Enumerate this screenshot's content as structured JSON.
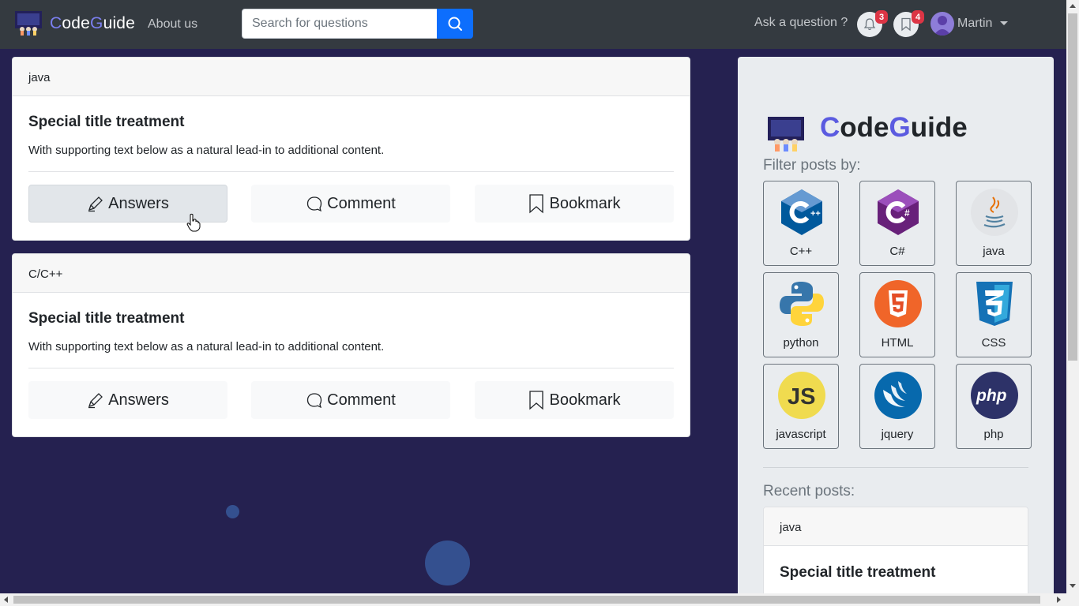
{
  "navbar": {
    "brand_first": "C",
    "brand_mid": "ode",
    "brand_accent": "G",
    "brand_rest": "uide",
    "about": "About us",
    "search_placeholder": "Search for questions",
    "ask": "Ask a question ?",
    "notifications_count": "3",
    "bookmarks_count": "4",
    "user": "Martin"
  },
  "posts": [
    {
      "tag": "java",
      "title": "Special title treatment",
      "text": "With supporting text below as a natural lead-in to additional content.",
      "answers": "Answers",
      "comment": "Comment",
      "bookmark": "Bookmark"
    },
    {
      "tag": "C/C++",
      "title": "Special title treatment",
      "text": "With supporting text below as a natural lead-in to additional content.",
      "answers": "Answers",
      "comment": "Comment",
      "bookmark": "Bookmark"
    }
  ],
  "sidebar": {
    "brand_first": "C",
    "brand_mid": "ode",
    "brand_accent": "G",
    "brand_rest": "uide",
    "filter_label": "Filter posts by:",
    "languages": [
      "C++",
      "C#",
      "java",
      "python",
      "HTML",
      "CSS",
      "javascript",
      "jquery",
      "php"
    ],
    "recent_label": "Recent posts:",
    "recent": {
      "tag": "java",
      "title": "Special title treatment"
    }
  },
  "colors": {
    "page_bg": "#252150",
    "navbar_bg": "#343a40",
    "accent": "#0d6efd",
    "badge": "#dc3545",
    "brand_accent": "#5b5be0"
  }
}
